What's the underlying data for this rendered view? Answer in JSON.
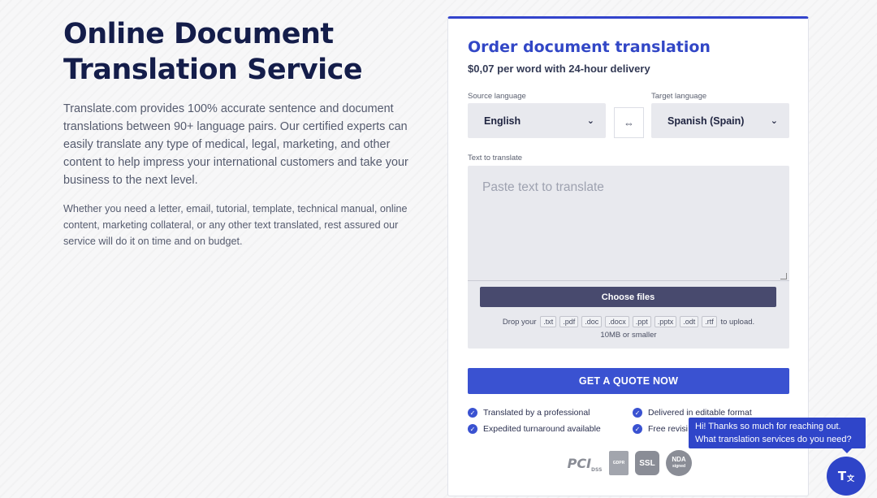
{
  "hero": {
    "title": "Online Document Translation Service",
    "paragraph1": "Translate.com provides 100% accurate sentence and document translations between 90+ language pairs. Our certified experts can easily translate any type of medical, legal, marketing, and other content to help impress your international customers and take your business to the next level.",
    "paragraph2": "Whether you need a letter, email, tutorial, template, technical manual, online content, marketing collateral, or any other text translated, rest assured our service will do it on time and on budget."
  },
  "order": {
    "title": "Order document translation",
    "subtitle": "$0,07 per word with 24-hour delivery",
    "source_label": "Source language",
    "source_value": "English",
    "target_label": "Target language",
    "target_value": "Spanish (Spain)",
    "swap_icon": "swap-arrows-icon",
    "text_label": "Text to translate",
    "text_placeholder": "Paste text to translate",
    "choose_files": "Choose files",
    "drop_prefix": "Drop your",
    "extensions": [
      ".txt",
      ".pdf",
      ".doc",
      ".docx",
      ".ppt",
      ".pptx",
      ".odt",
      ".rtf"
    ],
    "drop_suffix": "to upload.",
    "size_limit": "10MB or smaller",
    "cta": "GET A QUOTE NOW",
    "features": [
      "Translated by a professional",
      "Delivered in editable format",
      "Expedited turnaround available",
      "Free revisi"
    ],
    "badges": {
      "pci": "PCI",
      "pci_sub": "DSS",
      "gdpr": "GDPR",
      "ssl": "SSL",
      "nda": "NDA",
      "nda_sub": "signed"
    }
  },
  "chat": {
    "line1": "Hi! Thanks so much for reaching out.",
    "line2": "What translation services do you need?",
    "button": "T",
    "button_sub": "文"
  },
  "colors": {
    "accent": "#3a52d1",
    "heading": "#141d4a",
    "chat": "#2f45c9"
  }
}
